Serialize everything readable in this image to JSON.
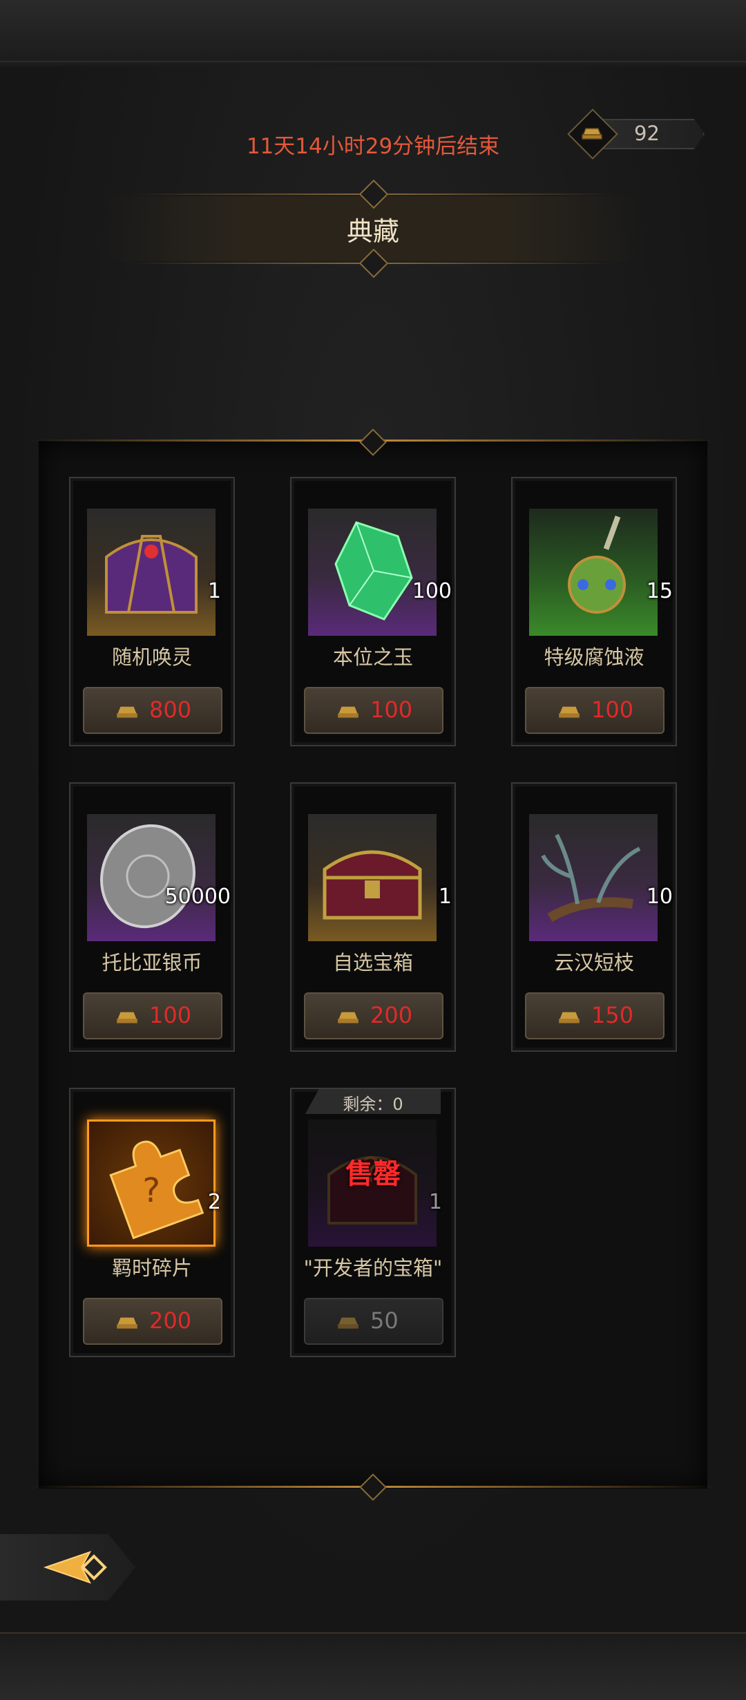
{
  "header": {
    "timer_text": "11天14小时29分钟后结束",
    "currency_value": "92",
    "currency_icon": "gold-ingot-icon"
  },
  "page": {
    "title": "典藏"
  },
  "colors": {
    "timer": "#e4583a",
    "price": "#e02a2a",
    "accent": "#c08a3a",
    "sold_out": "#ff2a2a"
  },
  "items": [
    {
      "name": "随机唤灵",
      "qty": "1",
      "price": "800",
      "icon": "purple-chest-icon",
      "rarity": "gold"
    },
    {
      "name": "本位之玉",
      "qty": "100",
      "price": "100",
      "icon": "green-crystal-icon",
      "rarity": "purple"
    },
    {
      "name": "特级腐蚀液",
      "qty": "15",
      "price": "100",
      "icon": "potion-flask-icon",
      "rarity": "green"
    },
    {
      "name": "托比亚银币",
      "qty": "50000",
      "price": "100",
      "icon": "silver-coin-icon",
      "rarity": "purple"
    },
    {
      "name": "自选宝箱",
      "qty": "1",
      "price": "200",
      "icon": "treasure-chest-icon",
      "rarity": "gold"
    },
    {
      "name": "云汉短枝",
      "qty": "10",
      "price": "150",
      "icon": "branch-icon",
      "rarity": "purple"
    },
    {
      "name": "羁时碎片",
      "qty": "2",
      "price": "200",
      "icon": "puzzle-piece-icon",
      "rarity": "orange"
    },
    {
      "name": "\"开发者的宝箱\"",
      "qty": "1",
      "price": "50",
      "icon": "mystery-chest-icon",
      "rarity": "purple",
      "sold_out": true,
      "remain_label": "剩余：0",
      "sold_label": "售罄"
    }
  ]
}
